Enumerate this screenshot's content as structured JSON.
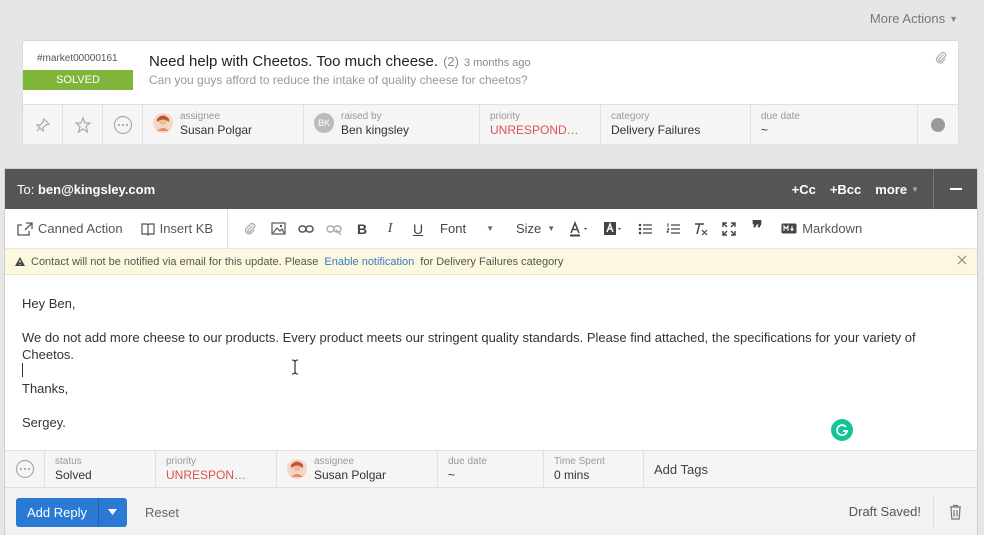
{
  "top": {
    "more_actions": "More Actions"
  },
  "ticket": {
    "id": "#market00000161",
    "status_badge": "SOLVED",
    "title": "Need help with Cheetos. Too much cheese.",
    "count": "(2)",
    "time": "3 months ago",
    "description": "Can you guys afford to reduce the intake of quality cheese for cheetos?",
    "meta": {
      "assignee_label": "assignee",
      "assignee_value": "Susan Polgar",
      "raised_label": "raised by",
      "raised_value": "Ben kingsley",
      "raised_initials": "BK",
      "priority_label": "priority",
      "priority_value": "UNRESPOND…",
      "category_label": "category",
      "category_value": "Delivery Failures",
      "due_label": "due date",
      "due_value": "~"
    }
  },
  "reply": {
    "to_prefix": "To:",
    "to_email": "ben@kingsley.com",
    "cc": "+Cc",
    "bcc": "+Bcc",
    "more": "more",
    "toolbar": {
      "canned": "Canned Action",
      "insert_kb": "Insert KB",
      "bold": "B",
      "italic": "I",
      "underline": "U",
      "font": "Font",
      "size": "Size",
      "markdown": "Markdown"
    },
    "notice": {
      "text_before": "Contact will not be notified via email for this update. Please",
      "link": "Enable notification",
      "text_after": "for Delivery Failures category"
    },
    "body": {
      "greeting": "Hey Ben,",
      "paragraph": "We do not add more cheese to our products. Every product meets our stringent quality standards. Please find attached, the specifications for your variety of Cheetos.",
      "thanks": "Thanks,",
      "signature": "Sergey."
    },
    "props": {
      "status_label": "status",
      "status_value": "Solved",
      "priority_label": "priority",
      "priority_value": "UNRESPON…",
      "assignee_label": "assignee",
      "assignee_value": "Susan Polgar",
      "due_label": "due date",
      "due_value": "~",
      "time_label": "Time Spent",
      "time_value": "0 mins",
      "tags": "Add Tags"
    },
    "actions": {
      "add_reply": "Add Reply",
      "reset": "Reset",
      "draft_saved": "Draft Saved!"
    }
  },
  "colors": {
    "accent": "#2a7ad3",
    "solved": "#7fb53b",
    "priority_red": "#d9534f",
    "header_dark": "#555555"
  }
}
